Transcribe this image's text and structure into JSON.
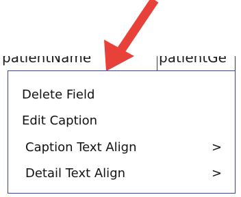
{
  "table_header": {
    "columns": [
      "patientName",
      "patientGe"
    ]
  },
  "context_menu": {
    "items": [
      {
        "label": "Delete Field"
      },
      {
        "label": "Edit Caption"
      },
      {
        "label": "Caption Text Align",
        "submenu_indicator": ">"
      },
      {
        "label": "Detail Text Align",
        "submenu_indicator": ">"
      }
    ]
  },
  "annotation": {
    "icon": "red-arrow-icon",
    "color": "#e8413a"
  },
  "colors": {
    "menu_border": "#2f3fc8"
  }
}
